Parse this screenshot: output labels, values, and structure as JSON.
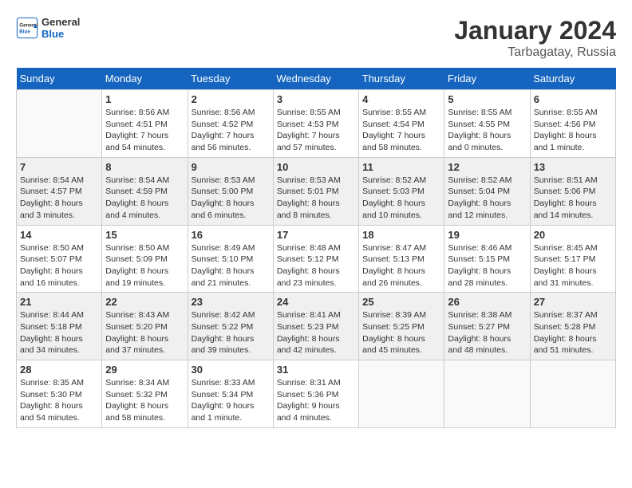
{
  "header": {
    "logo_general": "General",
    "logo_blue": "Blue",
    "title": "January 2024",
    "subtitle": "Tarbagatay, Russia"
  },
  "days_of_week": [
    "Sunday",
    "Monday",
    "Tuesday",
    "Wednesday",
    "Thursday",
    "Friday",
    "Saturday"
  ],
  "weeks": [
    [
      {
        "day": "",
        "info": ""
      },
      {
        "day": "1",
        "info": "Sunrise: 8:56 AM\nSunset: 4:51 PM\nDaylight: 7 hours\nand 54 minutes."
      },
      {
        "day": "2",
        "info": "Sunrise: 8:56 AM\nSunset: 4:52 PM\nDaylight: 7 hours\nand 56 minutes."
      },
      {
        "day": "3",
        "info": "Sunrise: 8:55 AM\nSunset: 4:53 PM\nDaylight: 7 hours\nand 57 minutes."
      },
      {
        "day": "4",
        "info": "Sunrise: 8:55 AM\nSunset: 4:54 PM\nDaylight: 7 hours\nand 58 minutes."
      },
      {
        "day": "5",
        "info": "Sunrise: 8:55 AM\nSunset: 4:55 PM\nDaylight: 8 hours\nand 0 minutes."
      },
      {
        "day": "6",
        "info": "Sunrise: 8:55 AM\nSunset: 4:56 PM\nDaylight: 8 hours\nand 1 minute."
      }
    ],
    [
      {
        "day": "7",
        "info": "Sunrise: 8:54 AM\nSunset: 4:57 PM\nDaylight: 8 hours\nand 3 minutes."
      },
      {
        "day": "8",
        "info": "Sunrise: 8:54 AM\nSunset: 4:59 PM\nDaylight: 8 hours\nand 4 minutes."
      },
      {
        "day": "9",
        "info": "Sunrise: 8:53 AM\nSunset: 5:00 PM\nDaylight: 8 hours\nand 6 minutes."
      },
      {
        "day": "10",
        "info": "Sunrise: 8:53 AM\nSunset: 5:01 PM\nDaylight: 8 hours\nand 8 minutes."
      },
      {
        "day": "11",
        "info": "Sunrise: 8:52 AM\nSunset: 5:03 PM\nDaylight: 8 hours\nand 10 minutes."
      },
      {
        "day": "12",
        "info": "Sunrise: 8:52 AM\nSunset: 5:04 PM\nDaylight: 8 hours\nand 12 minutes."
      },
      {
        "day": "13",
        "info": "Sunrise: 8:51 AM\nSunset: 5:06 PM\nDaylight: 8 hours\nand 14 minutes."
      }
    ],
    [
      {
        "day": "14",
        "info": "Sunrise: 8:50 AM\nSunset: 5:07 PM\nDaylight: 8 hours\nand 16 minutes."
      },
      {
        "day": "15",
        "info": "Sunrise: 8:50 AM\nSunset: 5:09 PM\nDaylight: 8 hours\nand 19 minutes."
      },
      {
        "day": "16",
        "info": "Sunrise: 8:49 AM\nSunset: 5:10 PM\nDaylight: 8 hours\nand 21 minutes."
      },
      {
        "day": "17",
        "info": "Sunrise: 8:48 AM\nSunset: 5:12 PM\nDaylight: 8 hours\nand 23 minutes."
      },
      {
        "day": "18",
        "info": "Sunrise: 8:47 AM\nSunset: 5:13 PM\nDaylight: 8 hours\nand 26 minutes."
      },
      {
        "day": "19",
        "info": "Sunrise: 8:46 AM\nSunset: 5:15 PM\nDaylight: 8 hours\nand 28 minutes."
      },
      {
        "day": "20",
        "info": "Sunrise: 8:45 AM\nSunset: 5:17 PM\nDaylight: 8 hours\nand 31 minutes."
      }
    ],
    [
      {
        "day": "21",
        "info": "Sunrise: 8:44 AM\nSunset: 5:18 PM\nDaylight: 8 hours\nand 34 minutes."
      },
      {
        "day": "22",
        "info": "Sunrise: 8:43 AM\nSunset: 5:20 PM\nDaylight: 8 hours\nand 37 minutes."
      },
      {
        "day": "23",
        "info": "Sunrise: 8:42 AM\nSunset: 5:22 PM\nDaylight: 8 hours\nand 39 minutes."
      },
      {
        "day": "24",
        "info": "Sunrise: 8:41 AM\nSunset: 5:23 PM\nDaylight: 8 hours\nand 42 minutes."
      },
      {
        "day": "25",
        "info": "Sunrise: 8:39 AM\nSunset: 5:25 PM\nDaylight: 8 hours\nand 45 minutes."
      },
      {
        "day": "26",
        "info": "Sunrise: 8:38 AM\nSunset: 5:27 PM\nDaylight: 8 hours\nand 48 minutes."
      },
      {
        "day": "27",
        "info": "Sunrise: 8:37 AM\nSunset: 5:28 PM\nDaylight: 8 hours\nand 51 minutes."
      }
    ],
    [
      {
        "day": "28",
        "info": "Sunrise: 8:35 AM\nSunset: 5:30 PM\nDaylight: 8 hours\nand 54 minutes."
      },
      {
        "day": "29",
        "info": "Sunrise: 8:34 AM\nSunset: 5:32 PM\nDaylight: 8 hours\nand 58 minutes."
      },
      {
        "day": "30",
        "info": "Sunrise: 8:33 AM\nSunset: 5:34 PM\nDaylight: 9 hours\nand 1 minute."
      },
      {
        "day": "31",
        "info": "Sunrise: 8:31 AM\nSunset: 5:36 PM\nDaylight: 9 hours\nand 4 minutes."
      },
      {
        "day": "",
        "info": ""
      },
      {
        "day": "",
        "info": ""
      },
      {
        "day": "",
        "info": ""
      }
    ]
  ]
}
